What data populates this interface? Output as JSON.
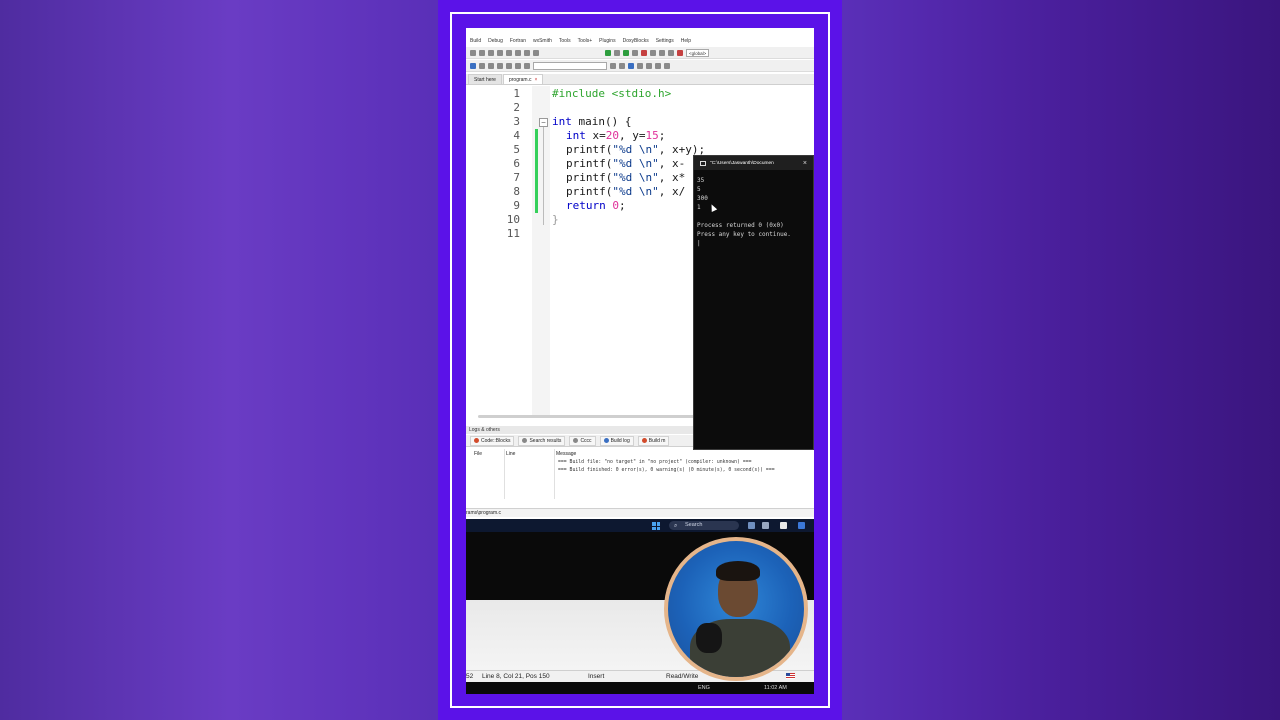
{
  "menu": [
    "Build",
    "Debug",
    "Fortran",
    "wxSmith",
    "Tools",
    "Tools+",
    "Plugins",
    "DoxyBlocks",
    "Settings",
    "Help"
  ],
  "toolbar": {
    "scope_select": "<global>"
  },
  "tabs": [
    {
      "label": "Start here"
    },
    {
      "label": "program.c",
      "close": "×"
    }
  ],
  "editor": {
    "line_numbers": [
      "1",
      "2",
      "3",
      "4",
      "5",
      "6",
      "7",
      "8",
      "9",
      "10",
      "11"
    ],
    "fold_marker": "−",
    "lines": {
      "l1": "#include <stdio.h>",
      "l3_kw": "int",
      "l3_rest": " main() {",
      "l4_kw": "int",
      "l4_a": " x=",
      "l4_n1": "20",
      "l4_b": ", y=",
      "l4_n2": "15",
      "l4_c": ";",
      "l5_a": "printf(",
      "l5_s": "\"%d \\n\"",
      "l5_b": ", x+y);",
      "l6_a": "printf(",
      "l6_s": "\"%d \\n\"",
      "l6_b": ", x-",
      "l7_a": "printf(",
      "l7_s": "\"%d \\n\"",
      "l7_b": ", x*",
      "l8_a": "printf(",
      "l8_s": "\"%d \\n\"",
      "l8_b": ", x/",
      "l9_kw": "return",
      "l9_n": " 0",
      "l9_c": ";",
      "l10": "}"
    }
  },
  "console": {
    "title": "\"C:\\Users\\Jaswanth\\Documen",
    "close": "×",
    "output": "35\n5\n300\n1\n\nProcess returned 0 (0x0)\nPress any key to continue.\n|"
  },
  "logs": {
    "header": "Logs & others",
    "tabs": [
      "Code::Blocks",
      "Search results",
      "Cccc",
      "Build log",
      "Build m"
    ],
    "columns": {
      "file": "File",
      "line": "Line",
      "message": "Message"
    },
    "messages": [
      "=== Build file: \"no target\" in \"no project\" (compiler: unknown) ===",
      "=== Build finished: 0 error(s), 0 warning(s) (0 minute(s), 0 second(s)) ==="
    ]
  },
  "path_bar": "rams\\program.c",
  "taskbar": {
    "search_placeholder": "Search"
  },
  "status": {
    "pos_prefix": "52",
    "position": "Line 8, Col 21, Pos 150",
    "mode": "Insert",
    "access": "Read/Write"
  },
  "bottom": {
    "lang": "ENG",
    "time": "11:02 AM"
  }
}
